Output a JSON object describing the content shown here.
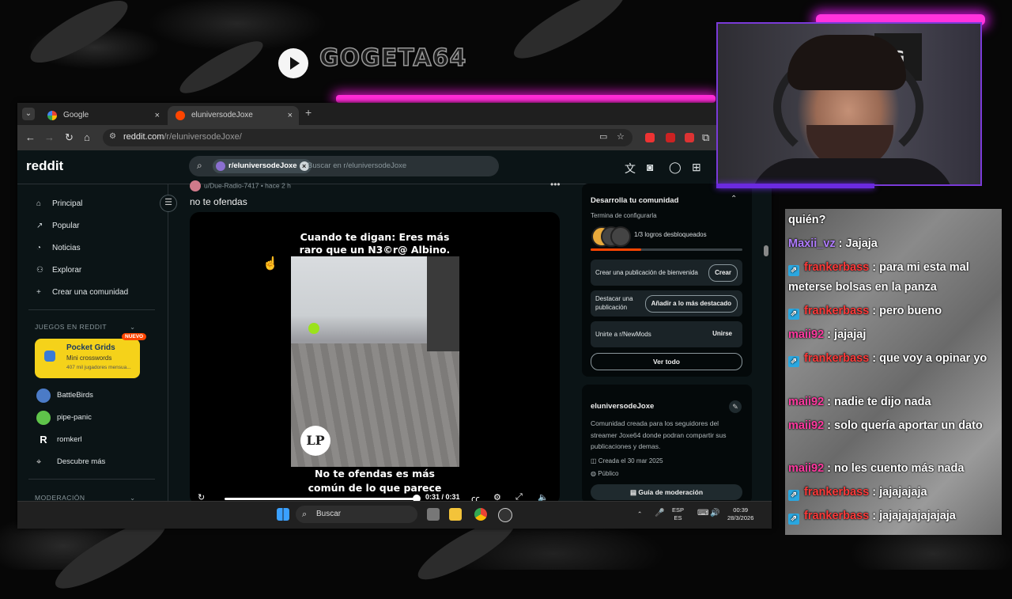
{
  "overlay": {
    "channel_name": "GOGETA64",
    "youtube_icon": "youtube-play-icon"
  },
  "browser": {
    "tabs": [
      {
        "label": "Google",
        "close": "×"
      },
      {
        "label": "eluniversodeJoxe",
        "close": "×"
      }
    ],
    "new_tab": "+",
    "url_domain": "reddit.com",
    "url_path": "/r/eluniversodeJoxe/"
  },
  "reddit": {
    "logo": "reddit",
    "search": {
      "chip": "r/eluniversodeJoxe",
      "placeholder": "Buscar en r/eluniversodeJoxe"
    },
    "nav": [
      {
        "icon": "⌂",
        "label": "Principal"
      },
      {
        "icon": "↗",
        "label": "Popular"
      },
      {
        "icon": "◔",
        "label": "Noticias"
      },
      {
        "icon": "⚇",
        "label": "Explorar"
      },
      {
        "icon": "+",
        "label": "Crear una comunidad"
      }
    ],
    "games_header": "JUEGOS EN REDDIT",
    "featured_game": {
      "title": "Pocket Grids",
      "subtitle": "Mini crosswords",
      "players": "407 mil jugadores mensua...",
      "badge": "NUEVO"
    },
    "games": [
      {
        "label": "BattleBirds",
        "color": "#4b7bc7"
      },
      {
        "label": "pipe-panic",
        "color": "#5fc44a"
      },
      {
        "label": "romkerl",
        "color": "#ffffff"
      },
      {
        "label": "Descubre más",
        "color": ""
      }
    ],
    "moderation_header": "MODERACIÓN",
    "post": {
      "author": "u/Due-Radio-7417",
      "time": "• hace 2 h",
      "title": "no te ofendas",
      "caption_top_1": "Cuando te digan: Eres más",
      "caption_top_2": "raro que un N3©r@ Albino.",
      "caption_bottom_1": "No te ofendas es más",
      "caption_bottom_2": "común de lo que parece",
      "watermark": "LP",
      "time_display": "0:31 / 0:31",
      "progress": 1.0
    },
    "sidebar": {
      "dev_title": "Desarrolla tu comunidad",
      "dev_subtitle": "Termina de configurarla",
      "achievements": "1/3 logros desbloqueados",
      "rows": [
        {
          "text": "Crear una publicación de bienvenida",
          "button": "Crear"
        },
        {
          "text": "Destacar una publicación",
          "button": "Añadir a lo más destacado"
        },
        {
          "text": "Unirte a r/NewMods",
          "button": "Unirse"
        }
      ],
      "see_all": "Ver todo",
      "community_name": "eluniversodeJoxe",
      "community_desc": "Comunidad creada para los seguidores del streamer Joxe64 donde podran compartir sus publicaciones y demas.",
      "created": "Creada el 30 mar 2025",
      "visibility": "Público",
      "mod_guide": "Guía de moderación"
    }
  },
  "taskbar": {
    "search_label": "Buscar",
    "lang_1": "ESP",
    "lang_2": "ES",
    "time": "00:39",
    "date": "28/3/2026"
  },
  "chat": [
    {
      "user": "",
      "text": "quién?",
      "color": "",
      "badge": false
    },
    {
      "user": "Maxii_vz",
      "text": " : Jajaja",
      "color": "#b07cff",
      "badge": false
    },
    {
      "user": "frankerbass",
      "text": " : para mi esta mal meterse bolsas en la panza",
      "color": "#ff3a3a",
      "badge": true
    },
    {
      "user": "frankerbass",
      "text": " : pero bueno",
      "color": "#ff3a3a",
      "badge": true
    },
    {
      "user": "maii92",
      "text": " : jajajaj",
      "color": "#ff3aa0",
      "badge": false
    },
    {
      "user": "frankerbass",
      "text": " : que voy a opinar yo",
      "color": "#ff3a3a",
      "badge": true
    },
    {
      "user": "maii92",
      "text": " : nadie te dijo nada",
      "color": "#ff3aa0",
      "badge": false
    },
    {
      "user": "maii92",
      "text": " : solo quería aportar un dato",
      "color": "#ff3aa0",
      "badge": false
    },
    {
      "user": "maii92",
      "text": " : no les cuento más nada",
      "color": "#ff3aa0",
      "badge": false
    },
    {
      "user": "frankerbass",
      "text": " : jajajajaja",
      "color": "#ff3a3a",
      "badge": true
    },
    {
      "user": "frankerbass",
      "text": " : jajajajajajajaja",
      "color": "#ff3a3a",
      "badge": true
    }
  ]
}
